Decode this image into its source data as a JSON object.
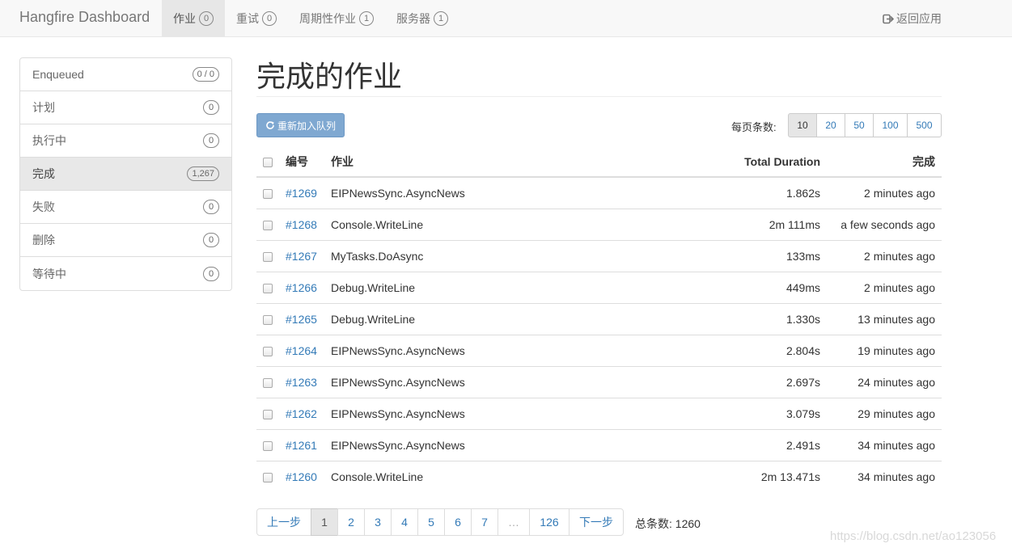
{
  "navbar": {
    "brand": "Hangfire Dashboard",
    "items": [
      {
        "label": "作业",
        "count": "0"
      },
      {
        "label": "重试",
        "count": "0"
      },
      {
        "label": "周期性作业",
        "count": "1"
      },
      {
        "label": "服务器",
        "count": "1"
      }
    ],
    "back_label": "返回应用",
    "back_icon": "sign-out-icon"
  },
  "sidebar": {
    "items": [
      {
        "label": "Enqueued",
        "count": "0 / 0"
      },
      {
        "label": "计划",
        "count": "0"
      },
      {
        "label": "执行中",
        "count": "0"
      },
      {
        "label": "完成",
        "count": "1,267"
      },
      {
        "label": "失败",
        "count": "0"
      },
      {
        "label": "删除",
        "count": "0"
      },
      {
        "label": "等待中",
        "count": "0"
      }
    ]
  },
  "main": {
    "title": "完成的作业",
    "requeue_label": "重新加入队列",
    "requeue_icon": "refresh-icon",
    "per_page_label": "每页条数:",
    "per_page_options": [
      "10",
      "20",
      "50",
      "100",
      "500"
    ],
    "per_page_selected": "10",
    "table": {
      "headers": {
        "id": "编号",
        "job": "作业",
        "duration": "Total Duration",
        "done": "完成"
      },
      "rows": [
        {
          "id": "#1269",
          "job": "EIPNewsSync.AsyncNews",
          "duration": "1.862s",
          "done": "2 minutes ago"
        },
        {
          "id": "#1268",
          "job": "Console.WriteLine",
          "duration": "2m 111ms",
          "done": "a few seconds ago"
        },
        {
          "id": "#1267",
          "job": "MyTasks.DoAsync",
          "duration": "133ms",
          "done": "2 minutes ago"
        },
        {
          "id": "#1266",
          "job": "Debug.WriteLine",
          "duration": "449ms",
          "done": "2 minutes ago"
        },
        {
          "id": "#1265",
          "job": "Debug.WriteLine",
          "duration": "1.330s",
          "done": "13 minutes ago"
        },
        {
          "id": "#1264",
          "job": "EIPNewsSync.AsyncNews",
          "duration": "2.804s",
          "done": "19 minutes ago"
        },
        {
          "id": "#1263",
          "job": "EIPNewsSync.AsyncNews",
          "duration": "2.697s",
          "done": "24 minutes ago"
        },
        {
          "id": "#1262",
          "job": "EIPNewsSync.AsyncNews",
          "duration": "3.079s",
          "done": "29 minutes ago"
        },
        {
          "id": "#1261",
          "job": "EIPNewsSync.AsyncNews",
          "duration": "2.491s",
          "done": "34 minutes ago"
        },
        {
          "id": "#1260",
          "job": "Console.WriteLine",
          "duration": "2m 13.471s",
          "done": "34 minutes ago"
        }
      ]
    },
    "pagination": {
      "prev": "上一步",
      "pages": [
        "1",
        "2",
        "3",
        "4",
        "5",
        "6",
        "7",
        "…",
        "126"
      ],
      "current": "1",
      "next": "下一步",
      "total_label": "总条数:",
      "total_value": "1260"
    }
  },
  "watermark": "https://blog.csdn.net/ao123056"
}
